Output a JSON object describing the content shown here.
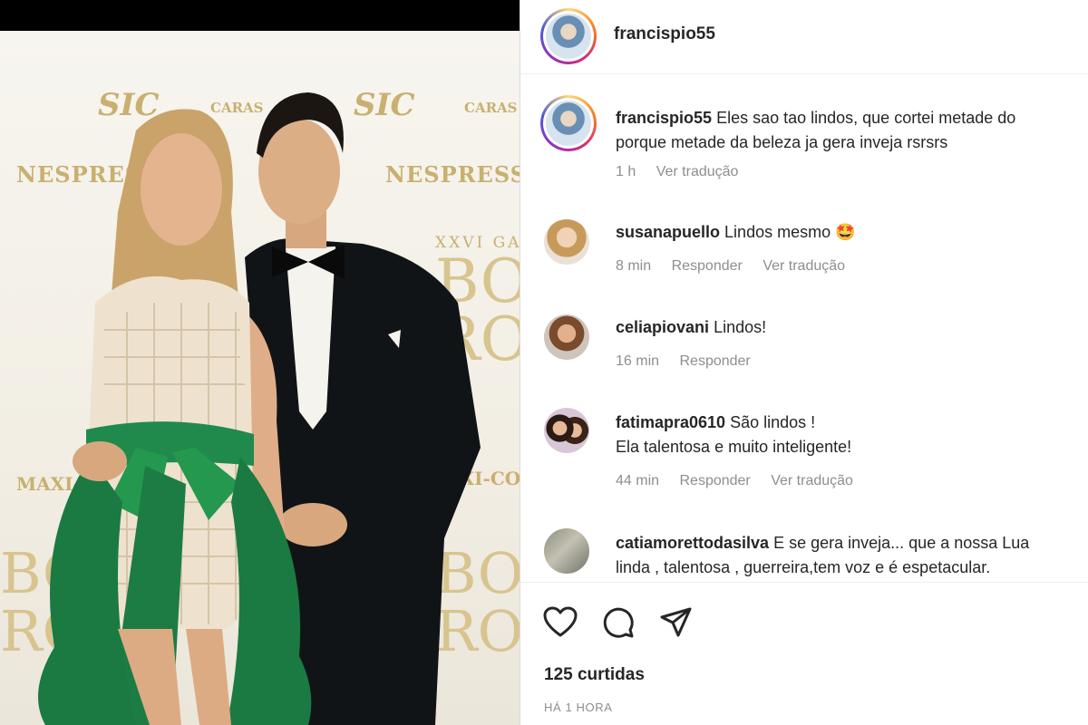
{
  "photo": {
    "backdrop_logos": {
      "sic": "SIC",
      "caras": "CARAS",
      "nespresso": "NESPRESSO",
      "maxicosi": "MAXI-COSI",
      "gala": "XXVI GALA",
      "bos": "BOS",
      "ro": "RO"
    }
  },
  "header": {
    "username": "francispio55"
  },
  "comments": [
    {
      "username": "francispio55",
      "text_line1": "Eles sao tao lindos, que cortei metade do",
      "text_line2": "porque metade da beleza ja gera inveja rsrsrs",
      "time": "1 h",
      "reply": "",
      "translate": "Ver tradução"
    },
    {
      "username": "susanapuello",
      "text_line1": "Lindos mesmo 🤩",
      "text_line2": "",
      "time": "8 min",
      "reply": "Responder",
      "translate": "Ver tradução"
    },
    {
      "username": "celiapiovani",
      "text_line1": "Lindos!",
      "text_line2": "",
      "time": "16 min",
      "reply": "Responder",
      "translate": ""
    },
    {
      "username": "fatimapra0610",
      "text_line1": "São lindos !",
      "text_line2": "Ela talentosa e muito inteligente!",
      "time": "44 min",
      "reply": "Responder",
      "translate": "Ver tradução"
    },
    {
      "username": "catiamorettodasilva",
      "text_line1": "E se gera inveja... que a nossa Lua",
      "text_line2": "linda , talentosa , guerreira,tem voz e é espetacular.",
      "time": "",
      "reply": "",
      "translate": ""
    }
  ],
  "footer": {
    "likes": "125 curtidas",
    "posted": "HÁ 1 HORA",
    "icons": [
      "heart-icon",
      "comment-icon",
      "share-icon"
    ]
  },
  "colors": {
    "text": "#262626",
    "muted": "#8e8e8e",
    "gold": "#c9b071",
    "dress_green": "#1f8a4c"
  }
}
